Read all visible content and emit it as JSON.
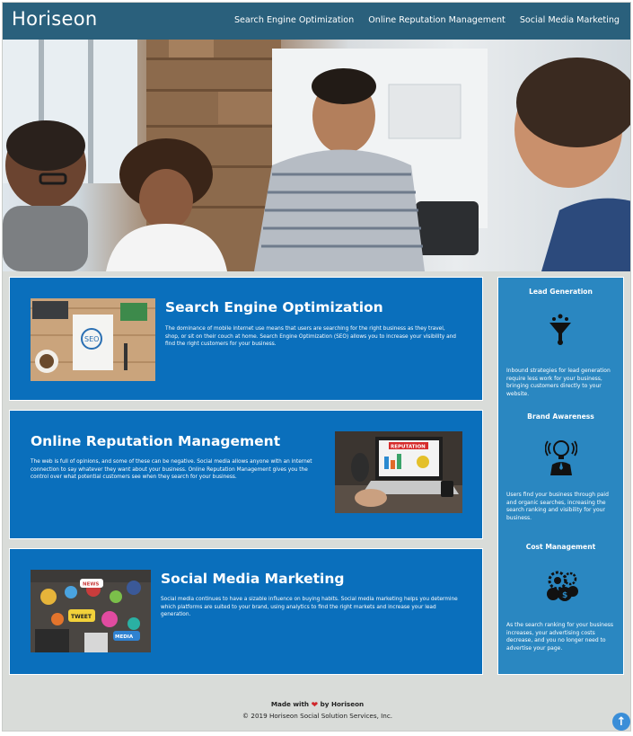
{
  "header": {
    "logo": "Horiseon",
    "nav": [
      {
        "label": "Search Engine Optimization"
      },
      {
        "label": "Online Reputation Management"
      },
      {
        "label": "Social Media Marketing"
      }
    ]
  },
  "colors": {
    "header_bg": "#2a607c",
    "card_bg": "#0a6fbc",
    "sidebar_bg": "#2a87c1",
    "page_bg": "#d9dcd9"
  },
  "content": [
    {
      "title": "Search Engine Optimization",
      "text": "The dominance of mobile internet use means that users are searching for the right business as they travel, shop, or sit on their couch at home. Search Engine Optimization (SEO) allows you to increase your visibility and find the right customers for your business."
    },
    {
      "title": "Online Reputation Management",
      "text": "The web is full of opinions, and some of these can be negative. Social media allows anyone with an internet connection to say whatever they want about your business. Online Reputation Management gives you the control over what potential customers see when they search for your business."
    },
    {
      "title": "Social Media Marketing",
      "text": "Social media continues to have a sizable influence on buying habits. Social media marketing helps you determine which platforms are suited to your brand, using analytics to find the right markets and increase your lead generation."
    }
  ],
  "images": {
    "seo_badge": "SEO",
    "reputation_banner": "REPUTATION",
    "social_tweet": "TWEET",
    "social_news": "NEWS",
    "social_media": "MEDIA"
  },
  "sidebar": [
    {
      "title": "Lead Generation",
      "icon": "funnel-icon",
      "text": "Inbound strategies for lead generation require less work for your business, bringing customers directly to your website."
    },
    {
      "title": "Brand Awareness",
      "icon": "lightbulb-person-icon",
      "text": "Users find your business through paid and organic searches, increasing the search ranking and visibility for your business."
    },
    {
      "title": "Cost Management",
      "icon": "gears-money-icon",
      "text": "As the search ranking for your business increases, your advertising costs decrease, and you no longer need to advertise your page."
    }
  ],
  "footer": {
    "made_prefix": "Made with",
    "made_suffix": "by Horiseon",
    "copyright": "© 2019 Horiseon Social Solution Services, Inc."
  },
  "scroll_top_icon": "arrow-up-icon"
}
